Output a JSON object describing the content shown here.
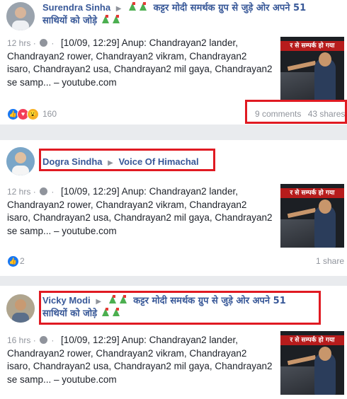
{
  "posts": [
    {
      "author": "Surendra Sinha",
      "group_line1": "कट्टर मोदी समर्थक ग्रुप से जुड़े ओर अपने 51",
      "group_line2": "साथियों को जोड़े",
      "time": "12 hrs",
      "text": "[10/09, 12:29] Anup: Chandrayan2 lander, Chandrayan2 rower, Chandrayan2 vikram, Chandrayan2 isaro, Chandrayan2 usa, Chandrayan2 mil gaya, Chandrayan2 se samp... – youtube.com",
      "thumb_caption": "र से सम्पर्क हो गया",
      "reaction_count": "160",
      "comments": "9 comments",
      "shares": "43 shares"
    },
    {
      "author": "Dogra Sindha",
      "group": "Voice Of Himachal",
      "time": "12 hrs",
      "text": "[10/09, 12:29] Anup: Chandrayan2 lander, Chandrayan2 rower, Chandrayan2 vikram, Chandrayan2 isaro, Chandrayan2 usa, Chandrayan2 mil gaya, Chandrayan2 se samp... – youtube.com",
      "thumb_caption": "र से सम्पर्क हो गया",
      "reaction_count": "2",
      "shares": "1 share"
    },
    {
      "author": "Vicky Modi",
      "group_line1": "कट्टर मोदी समर्थक ग्रुप से जुड़े ओर अपने 51",
      "group_line2": "साथियों को जोड़े",
      "time": "16 hrs",
      "text": "[10/09, 12:29] Anup: Chandrayan2 lander, Chandrayan2 rower, Chandrayan2 vikram, Chandrayan2 isaro, Chandrayan2 usa, Chandrayan2 mil gaya, Chandrayan2 se samp... – youtube.com",
      "thumb_caption": "र से सम्पर्क हो गया"
    }
  ],
  "colors": {
    "link": "#385898",
    "highlight": "#e01a22",
    "like": "#1877f2",
    "love": "#f33e58",
    "wow": "#f7b125"
  },
  "icons": [
    "play-arrow-icon",
    "flag-emoji-icon",
    "globe-icon",
    "like-reaction-icon",
    "love-reaction-icon",
    "wow-reaction-icon"
  ]
}
